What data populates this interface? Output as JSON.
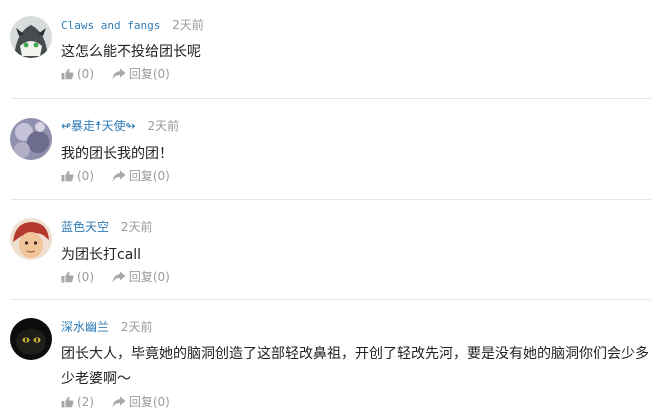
{
  "comments": [
    {
      "username": "Claws and fangs",
      "time": "2天前",
      "text": "这怎么能不投给团长呢",
      "likes": "(0)",
      "reply_label": "回复",
      "replies": "(0)"
    },
    {
      "username": "↫暴走☨天使↬",
      "time": "2天前",
      "text": "我的团长我的团！",
      "likes": "(0)",
      "reply_label": "回复",
      "replies": "(0)"
    },
    {
      "username": "蓝色天空",
      "time": "2天前",
      "text": "为团长打call",
      "likes": "(0)",
      "reply_label": "回复",
      "replies": "(0)"
    },
    {
      "username": "深水幽兰",
      "time": "2天前",
      "text": "团长大人，毕竟她的脑洞创造了这部轻改鼻祖，开创了轻改先河，要是没有她的脑洞你们会少多少老婆啊～",
      "likes": "(2)",
      "reply_label": "回复",
      "replies": "(0)"
    }
  ],
  "icons": {
    "like": "thumbs-up-icon",
    "reply": "reply-arrow-icon"
  },
  "colors": {
    "username": "#2e7bb6",
    "muted": "#999999",
    "divider": "#e5e5e5"
  }
}
